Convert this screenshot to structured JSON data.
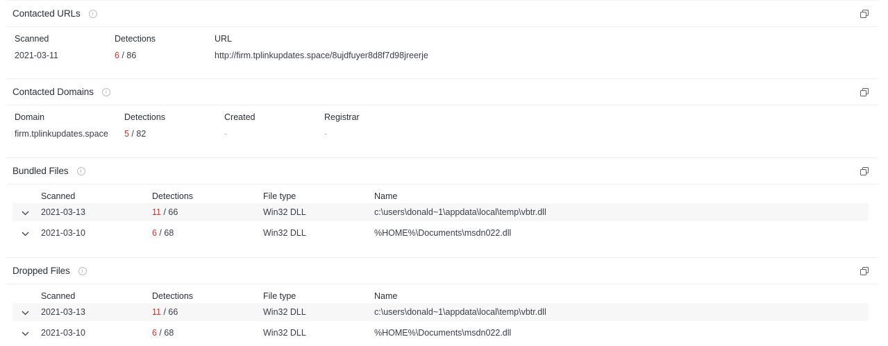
{
  "urls": {
    "title": "Contacted URLs",
    "columns": [
      "Scanned",
      "Detections",
      "URL"
    ],
    "rows": [
      {
        "scanned": "2021-03-11",
        "det_hit": "6",
        "det_total": " / 86",
        "url": "http://firm.tplinkupdates.space/8ujdfuyer8d8f7d98jreerje"
      }
    ]
  },
  "domains": {
    "title": "Contacted Domains",
    "columns": [
      "Domain",
      "Detections",
      "Created",
      "Registrar"
    ],
    "rows": [
      {
        "domain": "firm.tplinkupdates.space",
        "det_hit": "5",
        "det_total": " / 82",
        "created": "-",
        "registrar": "-"
      }
    ]
  },
  "bundled": {
    "title": "Bundled Files",
    "columns": [
      "Scanned",
      "Detections",
      "File type",
      "Name"
    ],
    "rows": [
      {
        "scanned": "2021-03-13",
        "det_hit": "11",
        "det_total": " / 66",
        "type": "Win32 DLL",
        "name": "c:\\users\\donald~1\\appdata\\local\\temp\\vbtr.dll"
      },
      {
        "scanned": "2021-03-10",
        "det_hit": "6",
        "det_total": " / 68",
        "type": "Win32 DLL",
        "name": "%HOME%\\Documents\\msdn022.dll"
      }
    ]
  },
  "dropped": {
    "title": "Dropped Files",
    "columns": [
      "Scanned",
      "Detections",
      "File type",
      "Name"
    ],
    "rows": [
      {
        "scanned": "2021-03-13",
        "det_hit": "11",
        "det_total": " / 66",
        "type": "Win32 DLL",
        "name": "c:\\users\\donald~1\\appdata\\local\\temp\\vbtr.dll"
      },
      {
        "scanned": "2021-03-10",
        "det_hit": "6",
        "det_total": " / 68",
        "type": "Win32 DLL",
        "name": "%HOME%\\Documents\\msdn022.dll"
      }
    ]
  },
  "icons": {
    "info": "info-icon",
    "copy": "copy-icon",
    "expand": "chevron-down-icon"
  },
  "colors": {
    "detection_hit": "#d9302c",
    "border": "#eceef2",
    "row_highlight": "#f7f7f8"
  }
}
